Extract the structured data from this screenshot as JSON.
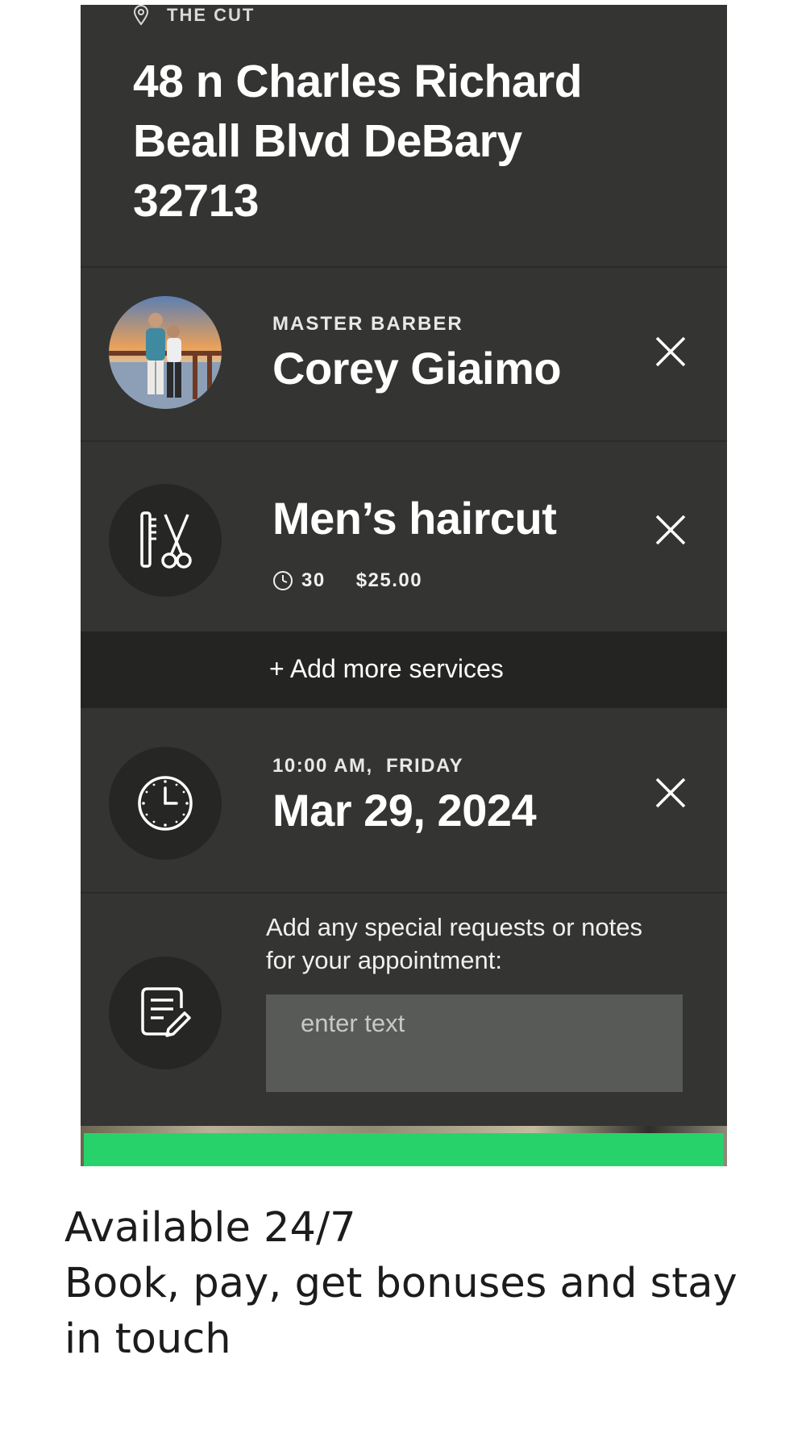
{
  "location": {
    "label": "THE CUT",
    "icon": "map-pin-icon"
  },
  "address": "48 n Charles Richard Beall Blvd DeBary 32713",
  "barber": {
    "role": "MASTER BARBER",
    "name": "Corey Giaimo",
    "avatar": "barber-avatar-photo"
  },
  "service": {
    "name": "Men’s haircut",
    "duration": "30",
    "price": "$25.00",
    "icon": "comb-scissors-icon"
  },
  "add_more_label": "+ Add more services",
  "appointment": {
    "time_day": "10:00 AM,  FRIDAY",
    "date": "Mar 29, 2024",
    "icon": "clock-icon"
  },
  "notes": {
    "label": "Add any special requests or notes for your appointment:",
    "placeholder": "enter text",
    "value": "",
    "icon": "notes-edit-icon"
  },
  "caption": {
    "line1": "Available 24/7",
    "line2": "Book, pay, get bonuses and stay in touch"
  },
  "colors": {
    "panel": "#343432",
    "dark": "#242423",
    "input": "#585a57",
    "accent_green": "#28d26a"
  }
}
